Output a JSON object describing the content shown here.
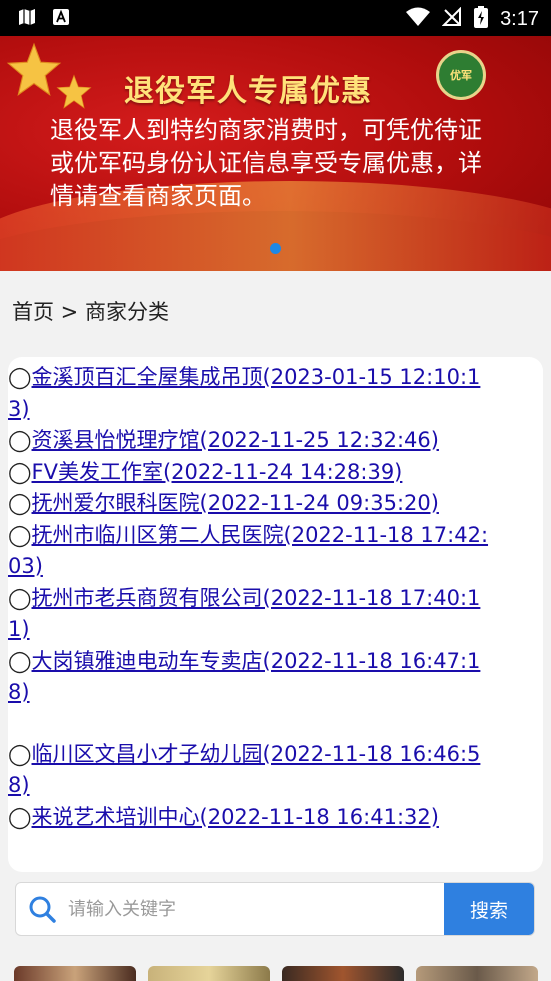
{
  "status_bar": {
    "time": "3:17"
  },
  "banner": {
    "title": "退役军人专属优惠",
    "description": "退役军人到特约商家消费时，可凭优待证或优军码身份认证信息享受专属优惠，详情请查看商家页面。",
    "emblem_text": "优军"
  },
  "breadcrumb": "首页 > 商家分类",
  "list": [
    {
      "bullet": "◯",
      "text": "金溪顶百汇全屋集成吊顶(2023-01-15 12:10:13)"
    },
    {
      "bullet": "◯",
      "text": "资溪县怡悦理疗馆(2022-11-25 12:32:46)"
    },
    {
      "bullet": "◯",
      "text": "FV美发工作室(2022-11-24 14:28:39)"
    },
    {
      "bullet": "◯",
      "text": "抚州爱尔眼科医院(2022-11-24 09:35:20)"
    },
    {
      "bullet": "◯",
      "text": "抚州市临川区第二人民医院(2022-11-18 17:42:03)"
    },
    {
      "bullet": "◯",
      "text": "抚州市老兵商贸有限公司(2022-11-18 17:40:11)"
    },
    {
      "bullet": "◯",
      "text": "大岗镇雅迪电动车专卖店(2022-11-18 16:47:18)"
    },
    {
      "bullet": "◯",
      "text": "临川区文昌小才子幼儿园(2022-11-18 16:46:58)"
    },
    {
      "bullet": "◯",
      "text": "来说艺术培训中心(2022-11-18 16:41:32)"
    }
  ],
  "search": {
    "placeholder": "请输入关键字",
    "button_label": "搜索"
  },
  "colors": {
    "accent": "#2f80e0",
    "link": "#1a0dab",
    "banner_red": "#b10d0d",
    "banner_gold": "#ffe27a"
  }
}
